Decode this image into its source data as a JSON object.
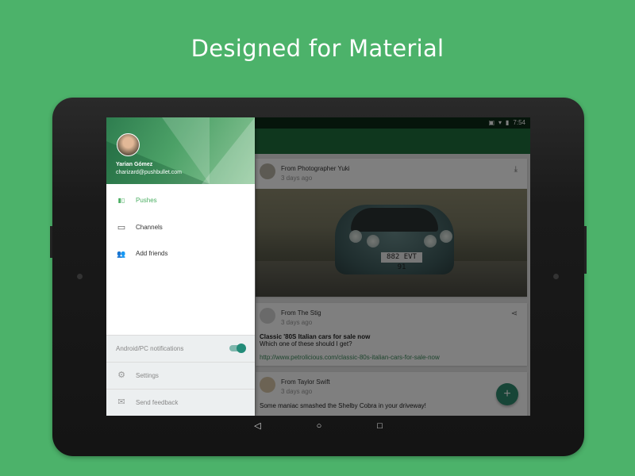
{
  "headline": "Designed for Material",
  "status": {
    "time": "7:54",
    "vibrate": "▣",
    "wifi": "▾",
    "battery": "▮"
  },
  "drawer": {
    "user_name": "Yarian Gómez",
    "user_email": "charizard@pushbullet.com",
    "items": [
      {
        "label": "Pushes",
        "icon": "pushes-icon",
        "glyph": "▮▯",
        "active": true
      },
      {
        "label": "Channels",
        "icon": "tv-icon",
        "glyph": "▭"
      },
      {
        "label": "Add friends",
        "icon": "people-icon",
        "glyph": "👥"
      }
    ],
    "notifications_label": "Android/PC notifications",
    "notifications_on": true,
    "settings_label": "Settings",
    "settings_glyph": "⚙",
    "feedback_label": "Send feedback",
    "feedback_glyph": "✉"
  },
  "feed": {
    "cards": [
      {
        "from": "From Photographer Yuki",
        "time": "3 days ago",
        "action_glyph": "⤓",
        "plate": "882 EVT 91"
      },
      {
        "from": "From The Stig",
        "time": "3 days ago",
        "action_glyph": "⋖",
        "title": "Classic '80S Italian cars for sale now",
        "body": "Which one of these should I get?",
        "link": "http://www.petrolicious.com/classic-80s-italian-cars-for-sale-now"
      },
      {
        "from": "From Taylor Swift",
        "time": "3 days ago",
        "body": "Some maniac smashed the Shelby Cobra in your driveway!"
      }
    ],
    "fab_glyph": "+"
  },
  "navbar": {
    "back": "◁",
    "home": "○",
    "recents": "□"
  },
  "colors": {
    "background": "#4cb26a",
    "accent": "#4caf63",
    "fab": "#2e8a6f"
  }
}
